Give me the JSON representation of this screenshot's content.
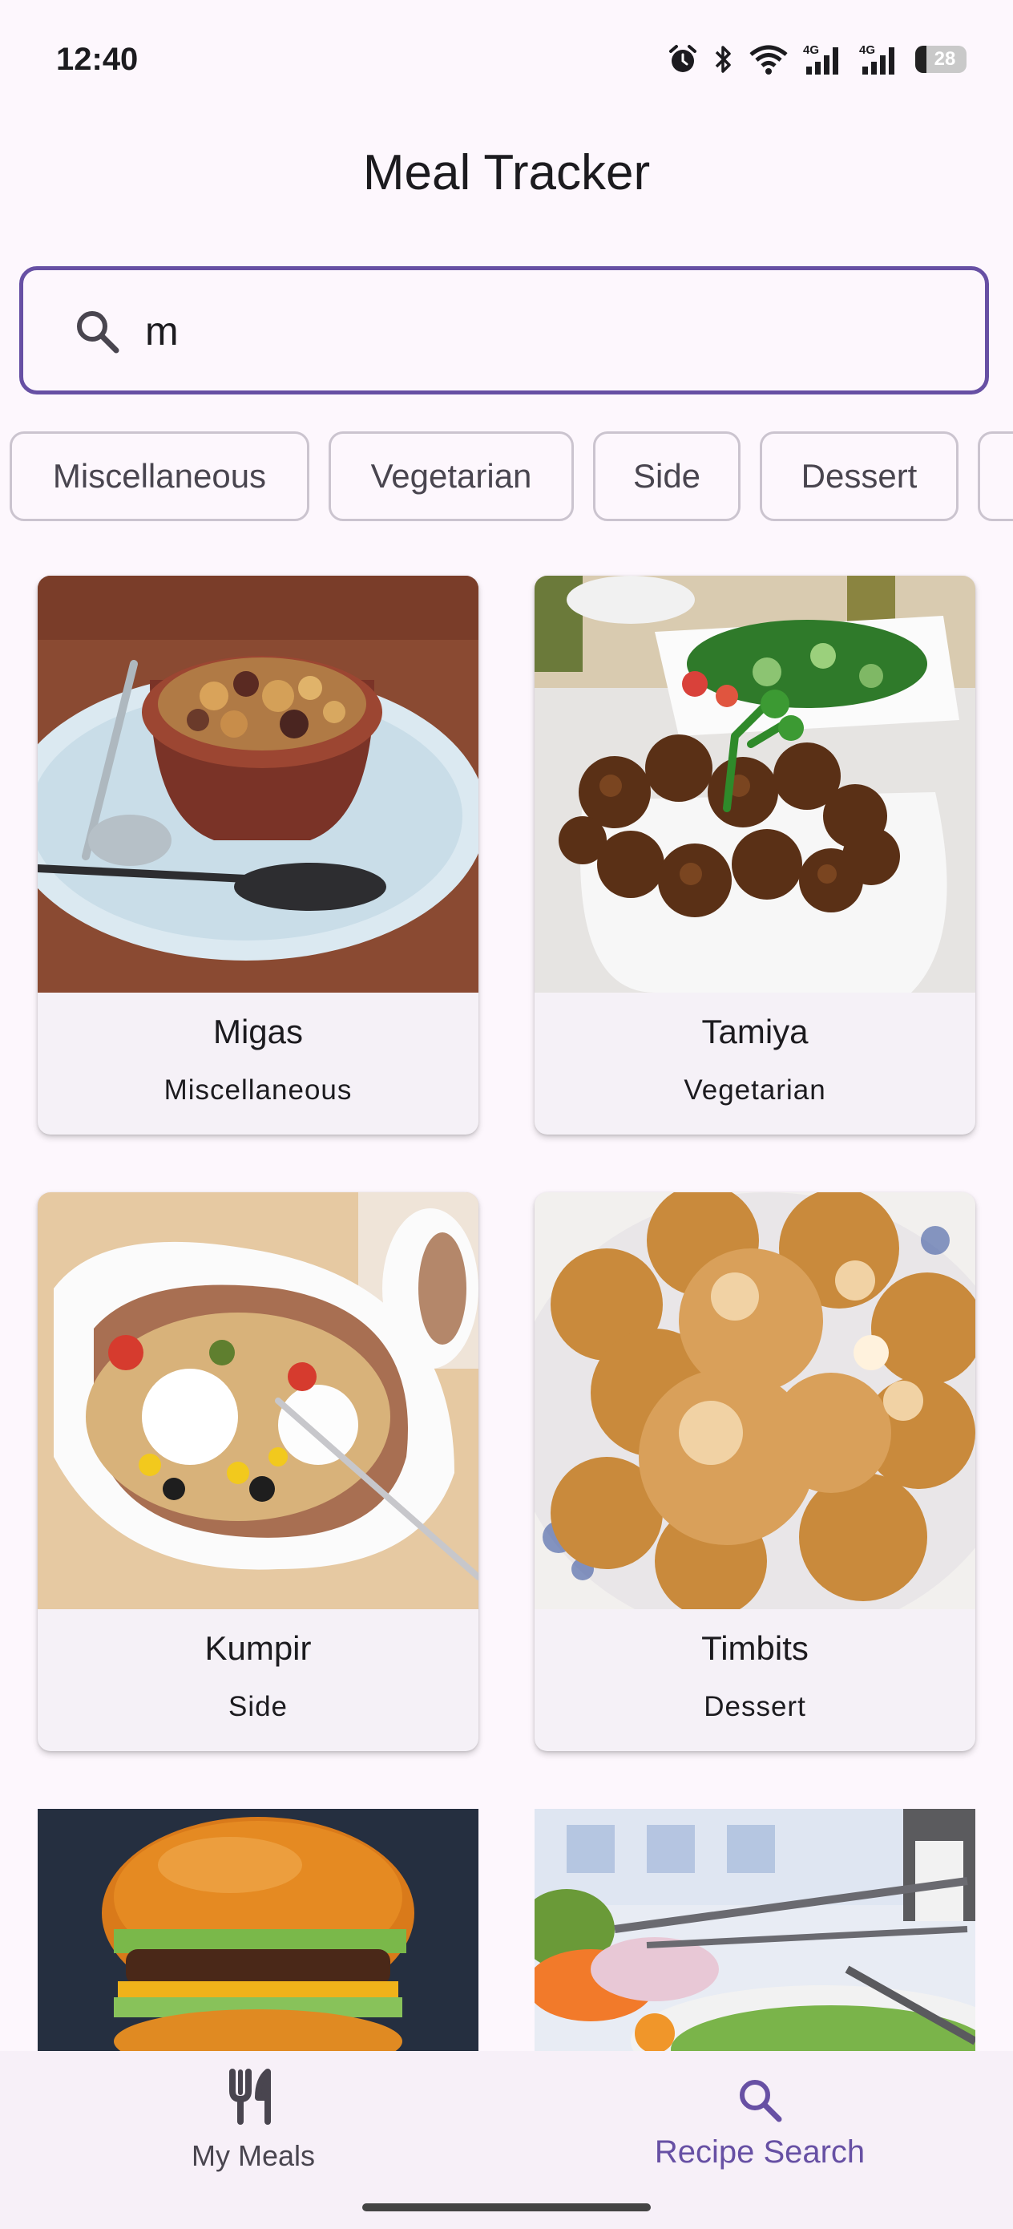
{
  "status_bar": {
    "time": "12:40",
    "battery": "28",
    "icons": [
      "alarm-icon",
      "bluetooth-icon",
      "wifi-icon",
      "signal-4g-icon",
      "signal-4g-icon",
      "battery-icon"
    ]
  },
  "app": {
    "title": "Meal Tracker"
  },
  "search": {
    "value": "m",
    "icon": "search-icon"
  },
  "chips": [
    {
      "label": "Miscellaneous"
    },
    {
      "label": "Vegetarian"
    },
    {
      "label": "Side"
    },
    {
      "label": "Dessert"
    }
  ],
  "meals": [
    {
      "name": "Migas",
      "category": "Miscellaneous"
    },
    {
      "name": "Tamiya",
      "category": "Vegetarian"
    },
    {
      "name": "Kumpir",
      "category": "Side"
    },
    {
      "name": "Timbits",
      "category": "Dessert"
    }
  ],
  "bottom_nav": {
    "items": [
      {
        "label": "My Meals",
        "icon": "fork-knife-icon",
        "selected": false
      },
      {
        "label": "Recipe Search",
        "icon": "search-icon",
        "selected": true
      }
    ]
  },
  "colors": {
    "accent": "#6750a4",
    "background": "#fdf7fd",
    "card": "#f5f1f7",
    "chip_border": "#cbc4cf",
    "nav_inactive": "#49454f"
  }
}
